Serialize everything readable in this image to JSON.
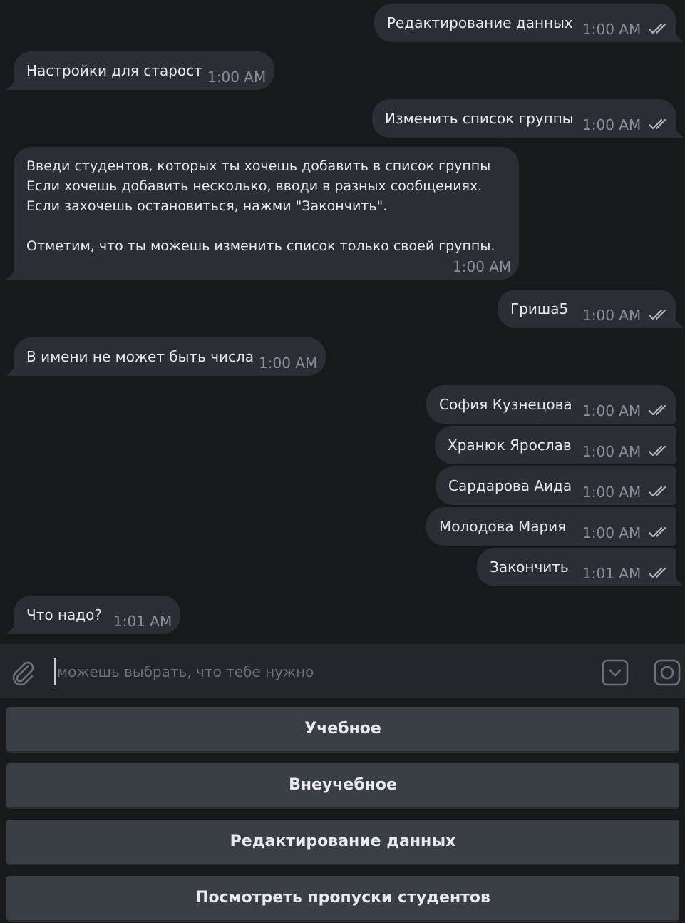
{
  "messages": [
    {
      "dir": "out",
      "text": "Редактирование данных",
      "time": "1:00 AM"
    },
    {
      "dir": "in",
      "text": "Настройки для старост",
      "time": "1:00 AM"
    },
    {
      "dir": "out",
      "text": "Изменить список группы",
      "time": "1:00 AM"
    },
    {
      "dir": "in",
      "text": "Введи студентов, которых ты хочешь добавить в список группы\nЕсли хочешь добавить несколько, вводи в разных сообщениях.\nЕсли захочешь остановиться, нажми \"Закончить\".\n\nОтметим, что ты можешь изменить список только своей группы.",
      "time": "1:00 AM"
    },
    {
      "dir": "out",
      "text": "Гриша5",
      "time": "1:00 AM"
    },
    {
      "dir": "in",
      "text": "В имени не может быть числа",
      "time": "1:00 AM"
    },
    {
      "dir": "out",
      "text": "София Кузнецова",
      "time": "1:00 AM"
    },
    {
      "dir": "out",
      "text": "Хранюк Ярослав",
      "time": "1:00 AM"
    },
    {
      "dir": "out",
      "text": "Сардарова Аида",
      "time": "1:00 AM"
    },
    {
      "dir": "out",
      "text": "Молодова Мария",
      "time": "1:00 AM"
    },
    {
      "dir": "out",
      "text": "Закончить",
      "time": "1:01 AM"
    },
    {
      "dir": "in",
      "text": "Что надо?",
      "time": "1:01 AM"
    }
  ],
  "composer": {
    "placeholder": "можешь выбрать, что тебе нужно"
  },
  "keyboard": {
    "buttons": [
      "Учебное",
      "Внеучебное",
      "Редактирование данных",
      "Посмотреть пропуски студентов"
    ]
  },
  "colors": {
    "background": "#17191c",
    "bubble": "#2b2f35",
    "time": "#8a9099",
    "composer": "#23262b",
    "keyboard_button": "#3a3e45"
  }
}
